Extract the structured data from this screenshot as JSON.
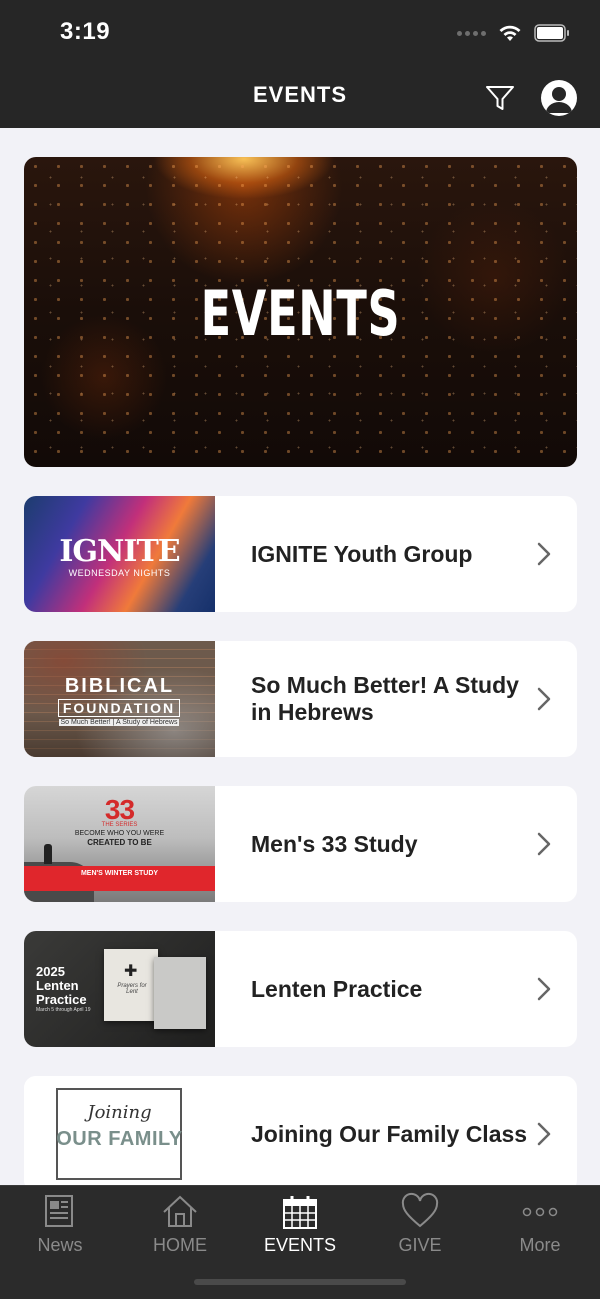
{
  "status_bar": {
    "time": "3:19"
  },
  "header": {
    "title": "EVENTS"
  },
  "hero": {
    "title": "EVENTS"
  },
  "events": [
    {
      "title": "IGNITE Youth Group",
      "thumb": {
        "headline": "IGNITE",
        "sub": "WEDNESDAY NIGHTS"
      }
    },
    {
      "title": "So Much Better! A Study in Hebrews",
      "thumb": {
        "line1": "BIBLICAL",
        "line2": "FOUNDATION",
        "line3": "So Much Better! | A Study of Hebrews"
      }
    },
    {
      "title": "Men's 33 Study",
      "thumb": {
        "num": "33",
        "sub1": "THE SERIES",
        "sub2": "BECOME WHO YOU WERE",
        "sub3": "CREATED TO BE",
        "band": "MEN'S WINTER STUDY"
      }
    },
    {
      "title": "Lenten Practice",
      "thumb": {
        "year": "2025",
        "l2": "Lenten",
        "l3": "Practice",
        "dates": "March 5 through April 19",
        "book": "Prayers for Lent"
      }
    },
    {
      "title": "Joining Our Family Class",
      "thumb": {
        "script": "Joining",
        "name": "OUR FAMILY"
      }
    }
  ],
  "tabbar": {
    "tabs": [
      {
        "label": "News",
        "icon": "news-icon"
      },
      {
        "label": "HOME",
        "icon": "home-icon"
      },
      {
        "label": "EVENTS",
        "icon": "calendar-icon",
        "active": true
      },
      {
        "label": "GIVE",
        "icon": "heart-icon"
      },
      {
        "label": "More",
        "icon": "more-icon"
      }
    ]
  },
  "colors": {
    "header_bg": "#262626",
    "page_bg": "#f2f2f7",
    "card_bg": "#ffffff",
    "tabbar_bg": "#2b2b2b",
    "active_tab": "#ffffff",
    "inactive_tab": "#8a8a8a"
  }
}
